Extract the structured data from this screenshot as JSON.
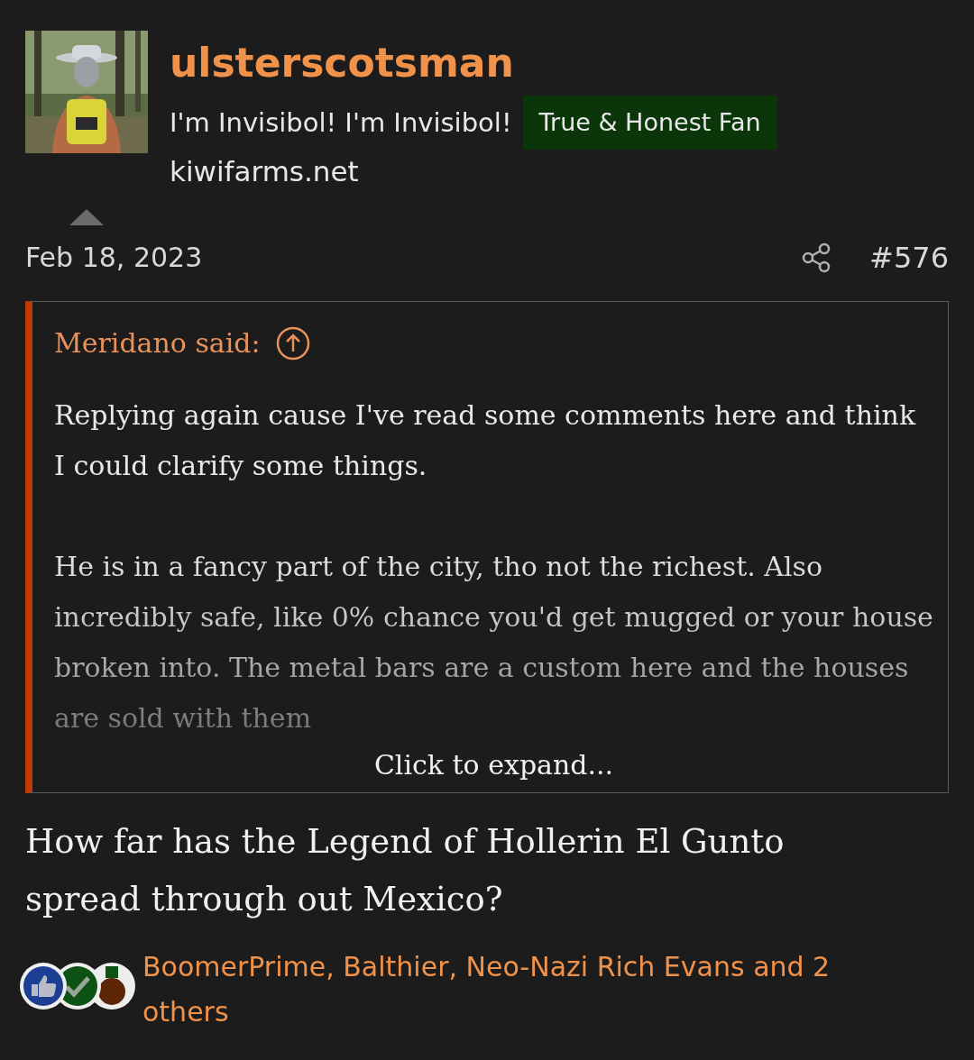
{
  "author": {
    "username": "ulsterscotsman",
    "title": "I'm Invisibol! I'm Invisibol!",
    "banner": "True & Honest Fan",
    "site": "kiwifarms.net"
  },
  "post": {
    "date": "Feb 18, 2023",
    "number": "#576"
  },
  "quote": {
    "attribution": "Meridano said:",
    "paragraphs": [
      "Replying again cause I've read some comments here and think I could clarify some things.",
      "He is in a fancy part of the city, tho not the richest. Also incredibly safe, like 0% chance you'd get mugged or your house broken into. The metal bars are a custom here and the houses are sold with them"
    ],
    "expand": "Click to expand..."
  },
  "body": "How far has the Legend of Hollerin El Gunto spread through out Mexico?",
  "reactions": {
    "icons": [
      {
        "kind": "like"
      },
      {
        "kind": "agree"
      },
      {
        "kind": "medal"
      }
    ],
    "text": "BoomerPrime, Balthier, Neo-Nazi Rich Evans and 2 others"
  }
}
